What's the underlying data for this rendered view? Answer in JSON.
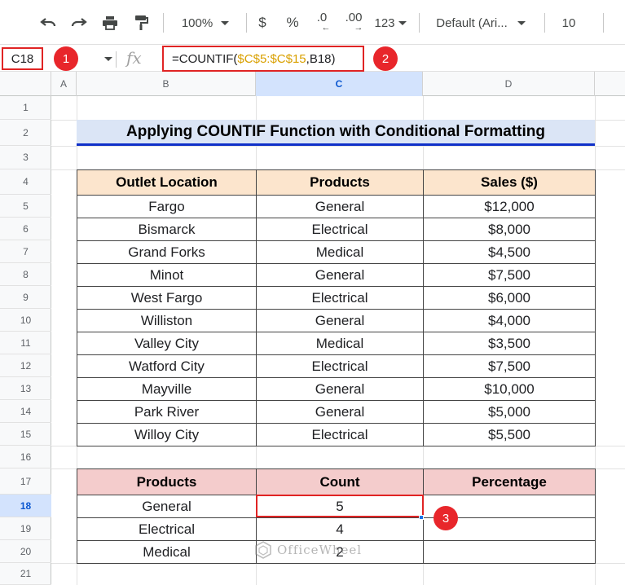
{
  "toolbar": {
    "zoom": "100%",
    "currency": "$",
    "percent": "%",
    "decrease_decimal": ".0",
    "increase_decimal": ".00",
    "more_formats": "123",
    "font": "Default (Ari...",
    "font_size": "10"
  },
  "formula_bar": {
    "cell_ref": "C18",
    "fx_label": "fx",
    "formula_prefix": "=COUNTIF(",
    "formula_range": "$C$5:$C$15",
    "formula_suffix": ",B18)"
  },
  "badges": [
    "1",
    "2",
    "3"
  ],
  "columns": [
    "A",
    "B",
    "C",
    "D"
  ],
  "rows": [
    "1",
    "2",
    "3",
    "4",
    "5",
    "6",
    "7",
    "8",
    "9",
    "10",
    "11",
    "12",
    "13",
    "14",
    "15",
    "16",
    "17",
    "18",
    "19",
    "20",
    "21"
  ],
  "title": "Applying COUNTIF Function with Conditional Formatting",
  "main_table": {
    "headers": [
      "Outlet Location",
      "Products",
      "Sales ($)"
    ],
    "rows": [
      [
        "Fargo",
        "General",
        "$12,000"
      ],
      [
        "Bismarck",
        "Electrical",
        "$8,000"
      ],
      [
        "Grand Forks",
        "Medical",
        "$4,500"
      ],
      [
        "Minot",
        "General",
        "$7,500"
      ],
      [
        "West Fargo",
        "Electrical",
        "$6,000"
      ],
      [
        "Williston",
        "General",
        "$4,000"
      ],
      [
        "Valley City",
        "Medical",
        "$3,500"
      ],
      [
        "Watford City",
        "Electrical",
        "$7,500"
      ],
      [
        "Mayville",
        "General",
        "$10,000"
      ],
      [
        "Park River",
        "General",
        "$5,000"
      ],
      [
        "Willoy City",
        "Electrical",
        "$5,500"
      ]
    ]
  },
  "count_table": {
    "headers": [
      "Products",
      "Count",
      "Percentage"
    ],
    "rows": [
      [
        "General",
        "5",
        ""
      ],
      [
        "Electrical",
        "4",
        ""
      ],
      [
        "Medical",
        "2",
        ""
      ]
    ]
  },
  "watermark": "OfficeWheel",
  "colors": {
    "highlight_red": "#e02424",
    "badge_red": "#e8262b",
    "title_bg": "#dbe5f6",
    "title_underline": "#1030c8",
    "main_header_bg": "#fce5cd",
    "count_header_bg": "#f4cccc",
    "formula_range": "#d9a000"
  }
}
